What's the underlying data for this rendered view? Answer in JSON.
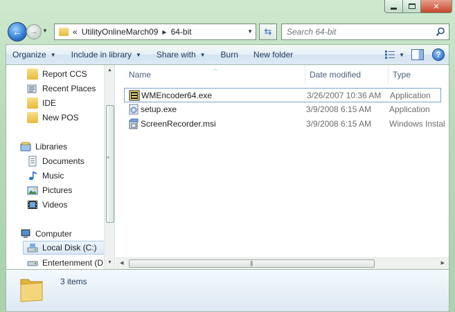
{
  "address": {
    "overflow": "«",
    "segments": [
      "UtilityOnlineMarch09",
      "64-bit"
    ]
  },
  "search": {
    "placeholder": "Search 64-bit"
  },
  "toolbar": {
    "organize": "Organize",
    "include_in_library": "Include in library",
    "share_with": "Share with",
    "burn": "Burn",
    "new_folder": "New folder"
  },
  "nav": {
    "items": [
      {
        "label": "Report CCS",
        "icon": "folder-icon"
      },
      {
        "label": "Recent Places",
        "icon": "recent-places-icon"
      },
      {
        "label": "IDE",
        "icon": "folder-icon"
      },
      {
        "label": "New POS",
        "icon": "folder-icon"
      },
      {
        "label": "Libraries",
        "icon": "libraries-icon"
      },
      {
        "label": "Documents",
        "icon": "documents-icon"
      },
      {
        "label": "Music",
        "icon": "music-icon"
      },
      {
        "label": "Pictures",
        "icon": "pictures-icon"
      },
      {
        "label": "Videos",
        "icon": "videos-icon"
      },
      {
        "label": "Computer",
        "icon": "computer-icon"
      },
      {
        "label": "Local Disk (C:)",
        "icon": "disk-icon"
      },
      {
        "label": "Entertenment (D:",
        "icon": "disk-icon"
      }
    ]
  },
  "columns": {
    "name": "Name",
    "date": "Date modified",
    "type": "Type"
  },
  "files": [
    {
      "name": "WMEncoder64.exe",
      "date": "3/26/2007 10:36 AM",
      "type": "Application"
    },
    {
      "name": "setup.exe",
      "date": "3/9/2008 6:15 AM",
      "type": "Application"
    },
    {
      "name": "ScreenRecorder.msi",
      "date": "3/9/2008 6:15 AM",
      "type": "Windows Installer"
    }
  ],
  "status": {
    "item_count": "3 items"
  },
  "colors": {
    "accent": "#1e395b",
    "folder": "#e7b93c",
    "frame": "#b6dab8"
  }
}
